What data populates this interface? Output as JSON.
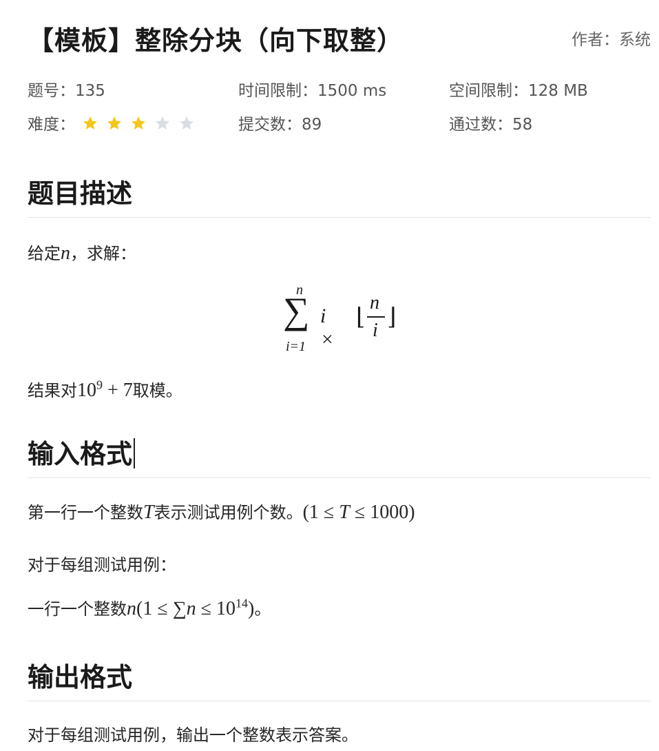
{
  "header": {
    "title": "【模板】整除分块（向下取整）",
    "author_label": "作者：",
    "author": "系统"
  },
  "meta": {
    "problem_id_label": "题号：",
    "problem_id": "135",
    "time_limit_label": "时间限制：",
    "time_limit": "1500 ms",
    "memory_limit_label": "空间限制：",
    "memory_limit": "128 MB",
    "difficulty_label": "难度：",
    "difficulty_rating": 3,
    "difficulty_max": 5,
    "submissions_label": "提交数：",
    "submissions": "89",
    "accepted_label": "通过数：",
    "accepted": "58"
  },
  "colors": {
    "star_filled": "#f5c518",
    "star_empty": "#d9dde3"
  },
  "sections": {
    "description": {
      "heading": "题目描述",
      "intro_prefix": "给定",
      "intro_var": "n",
      "intro_suffix": "，求解：",
      "formula": {
        "upper": "n",
        "sum": "∑",
        "lower": "i=1",
        "term": "i ×",
        "lfloor": "⌊",
        "num": "n",
        "den": "i",
        "rfloor": "⌋"
      },
      "mod_prefix": "结果对",
      "mod_base": "10",
      "mod_exp": "9",
      "mod_tail": " + 7",
      "mod_suffix": "取模。"
    },
    "input": {
      "heading": "输入格式",
      "line1_prefix": "第一行一个整数",
      "line1_var": "T",
      "line1_suffix": "表示测试用例个数。",
      "line1_constraint_open": "(1 ≤ ",
      "line1_constraint_var": "T",
      "line1_constraint_close": " ≤ 1000)",
      "line2": "对于每组测试用例：",
      "line3_prefix": "一行一个整数",
      "line3_var": "n",
      "line3_open": "(1 ≤ ∑",
      "line3_var2": "n",
      "line3_mid": " ≤ 10",
      "line3_exp": "14",
      "line3_close": ")",
      "line3_suffix": "。"
    },
    "output": {
      "heading": "输出格式",
      "line1": "对于每组测试用例，输出一个整数表示答案。"
    }
  }
}
